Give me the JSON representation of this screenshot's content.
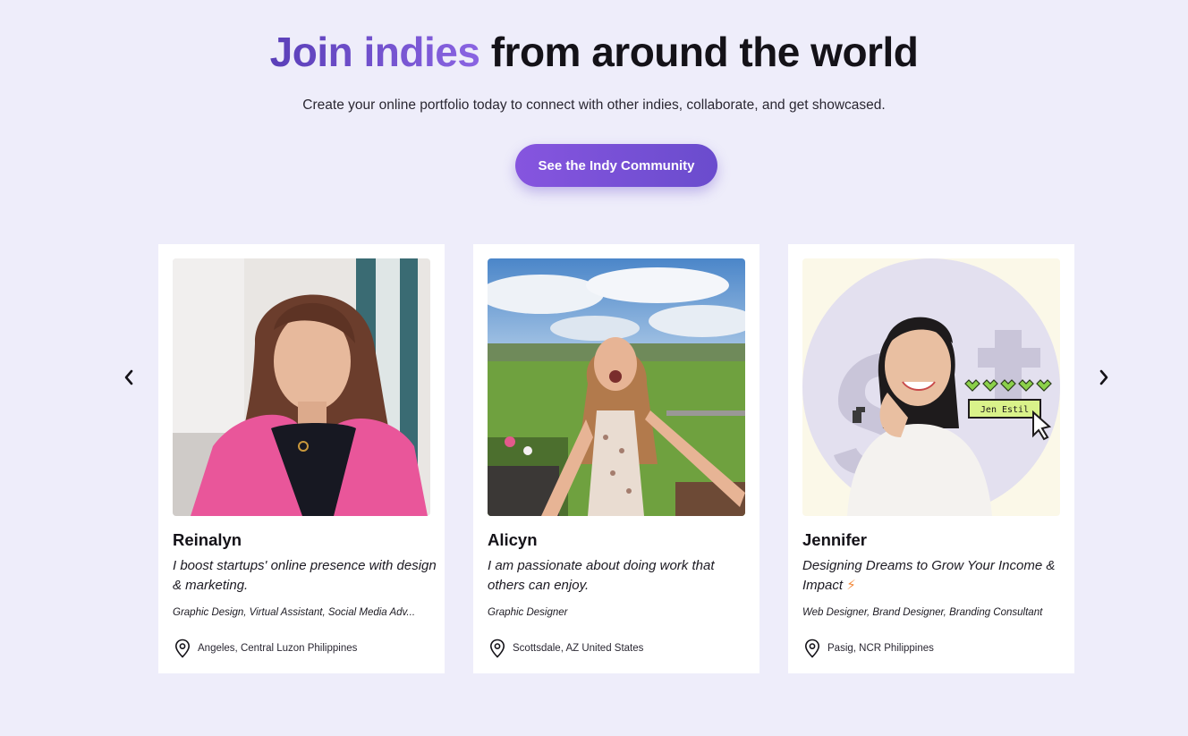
{
  "header": {
    "headline_accent": "Join indies",
    "headline_rest": "from around the world",
    "subtitle": "Create your online portfolio today to connect with other indies, collaborate, and get showcased.",
    "cta_label": "See the Indy Community"
  },
  "carousel": {
    "prev_icon": "chevron-left-icon",
    "next_icon": "chevron-right-icon",
    "cards": [
      {
        "name": "Reinalyn",
        "tagline": "I boost startups' online presence with design & marketing.",
        "skills": "Graphic Design, Virtual Assistant, Social Media Adv...",
        "location": "Angeles, Central Luzon Philippines"
      },
      {
        "name": "Alicyn",
        "tagline": "I am passionate about doing work that others can enjoy.",
        "skills": "Graphic Designer",
        "location": "Scottsdale, AZ United States"
      },
      {
        "name": "Jennifer",
        "tagline": "Designing Dreams to Grow Your Income & Impact",
        "tagline_emoji": "⚡",
        "skills": "Web Designer, Brand Designer, Branding Consultant",
        "location": "Pasig, NCR Philippines",
        "photo_badge": "Jen Estil"
      }
    ]
  },
  "colors": {
    "background": "#eeedfa",
    "accent_start": "#5a3fb8",
    "accent_end": "#8a64e2",
    "cta": "#7a52d8"
  }
}
